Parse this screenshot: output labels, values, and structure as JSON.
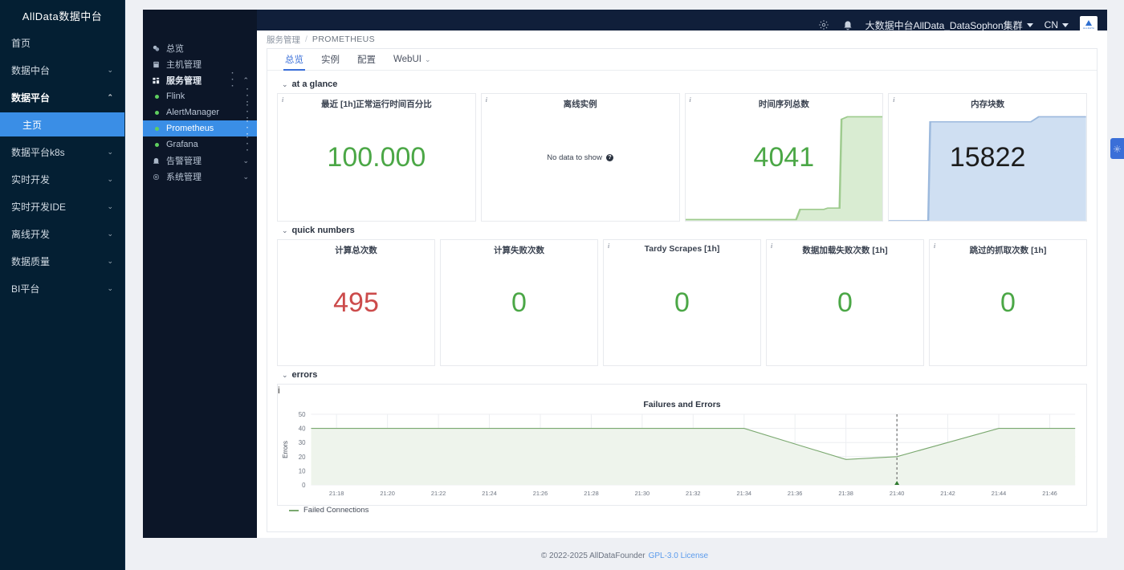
{
  "brand": {
    "title": "AllData数据中台"
  },
  "outer_nav": [
    {
      "label": "首页",
      "caret": "",
      "state": "normal"
    },
    {
      "label": "数据中台",
      "caret": "⌄",
      "state": "normal"
    },
    {
      "label": "数据平台",
      "caret": "⌃",
      "state": "expanded"
    },
    {
      "label": "主页",
      "caret": "",
      "state": "active"
    },
    {
      "label": "数据平台k8s",
      "caret": "⌄",
      "state": "normal"
    },
    {
      "label": "实时开发",
      "caret": "⌄",
      "state": "normal"
    },
    {
      "label": "实时开发IDE",
      "caret": "⌄",
      "state": "normal"
    },
    {
      "label": "离线开发",
      "caret": "⌄",
      "state": "normal"
    },
    {
      "label": "数据质量",
      "caret": "⌄",
      "state": "normal"
    },
    {
      "label": "BI平台",
      "caret": "⌄",
      "state": "normal"
    }
  ],
  "header": {
    "settings_icon": "gear-icon",
    "alert_icon": "bell-icon",
    "cluster": "大数据中台AllData_DataSophon集群",
    "language": "CN",
    "avatar_label": "ALLDATA"
  },
  "inner_nav": [
    {
      "label": "总览",
      "icon": "dashboard-icon",
      "type": "item"
    },
    {
      "label": "主机管理",
      "icon": "server-icon",
      "type": "item"
    },
    {
      "label": "服务管理",
      "icon": "grid-icon",
      "type": "group",
      "kebab": "⋮",
      "chev": "⌃"
    },
    {
      "label": "Flink",
      "type": "service",
      "status": "online",
      "kebab": "⋮"
    },
    {
      "label": "AlertManager",
      "type": "service",
      "status": "online",
      "kebab": "⋮"
    },
    {
      "label": "Prometheus",
      "type": "service",
      "status": "online",
      "kebab": "⋮",
      "active": true
    },
    {
      "label": "Grafana",
      "type": "service",
      "status": "online",
      "kebab": "⋮"
    },
    {
      "label": "告警管理",
      "icon": "alarm-icon",
      "type": "group",
      "chev": "⌄"
    },
    {
      "label": "系统管理",
      "icon": "gear-icon",
      "type": "group",
      "chev": "⌄"
    }
  ],
  "breadcrumb": {
    "parent": "服务管理",
    "sep": "/",
    "current": "PROMETHEUS"
  },
  "tabs": [
    {
      "label": "总览",
      "active": true
    },
    {
      "label": "实例",
      "active": false
    },
    {
      "label": "配置",
      "active": false
    },
    {
      "label": "WebUI",
      "active": false,
      "dropdown": "⌄"
    }
  ],
  "sections": [
    {
      "id": "at-a-glance",
      "toggle": "⌄",
      "label": "at a glance"
    },
    {
      "id": "quick-numbers",
      "toggle": "⌄",
      "label": "quick numbers"
    },
    {
      "id": "errors",
      "toggle": "⌄",
      "label": "errors"
    }
  ],
  "glance_cards": [
    {
      "title": "最近 [1h]正常运行时间百分比",
      "value": "100.000",
      "color": "green",
      "info": "i",
      "spark": "none"
    },
    {
      "title": "离线实例",
      "value": "",
      "empty_text": "No data to show",
      "info": "i",
      "spark": "none"
    },
    {
      "title": "时间序列总数",
      "value": "4041",
      "color": "green",
      "info": "i",
      "spark": "green"
    },
    {
      "title": "内存块数",
      "value": "15822",
      "color": "dark",
      "info": "i",
      "spark": "blue"
    }
  ],
  "quick_cards": [
    {
      "title": "计算总次数",
      "value": "495",
      "color": "red",
      "info": ""
    },
    {
      "title": "计算失败次数",
      "value": "0",
      "color": "green",
      "info": ""
    },
    {
      "title": "Tardy Scrapes [1h]",
      "value": "0",
      "color": "green",
      "info": "i"
    },
    {
      "title": "数据加载失败次数 [1h]",
      "value": "0",
      "color": "green",
      "info": "i"
    },
    {
      "title": "跳过的抓取次数 [1h]",
      "value": "0",
      "color": "green",
      "info": "i"
    }
  ],
  "errors_card": {
    "info": "i",
    "legend_label": "Failed Connections"
  },
  "chart_data": {
    "type": "area",
    "title": "Failures and Errors",
    "xlabel": "",
    "ylabel": "Errors",
    "ylim": [
      0,
      50
    ],
    "yticks": [
      0,
      10,
      20,
      30,
      40,
      50
    ],
    "grid": true,
    "legend_position": "bottom-left",
    "x": [
      "21:18",
      "21:20",
      "21:22",
      "21:24",
      "21:26",
      "21:28",
      "21:30",
      "21:32",
      "21:34",
      "21:36",
      "21:38",
      "21:40",
      "21:42",
      "21:44",
      "21:46"
    ],
    "marker": {
      "x": "21:40",
      "style": "dashed-vertical",
      "value": 20
    },
    "series": [
      {
        "name": "Failed Connections",
        "color": "#7aa86f",
        "fill": "#eef4ec",
        "values": [
          40,
          40,
          40,
          40,
          40,
          40,
          40,
          40,
          40,
          29,
          18,
          20,
          30,
          40,
          40
        ]
      }
    ]
  },
  "footer": {
    "copyright": "© 2022-2025 AllDataFounder",
    "link": "GPL-3.0 License"
  },
  "right_tab": {
    "icon": "gear-icon"
  },
  "colors": {
    "accent": "#3a8ee6",
    "green": "#4ba746",
    "red": "#cc4b4b",
    "link": "#5b9bec"
  }
}
